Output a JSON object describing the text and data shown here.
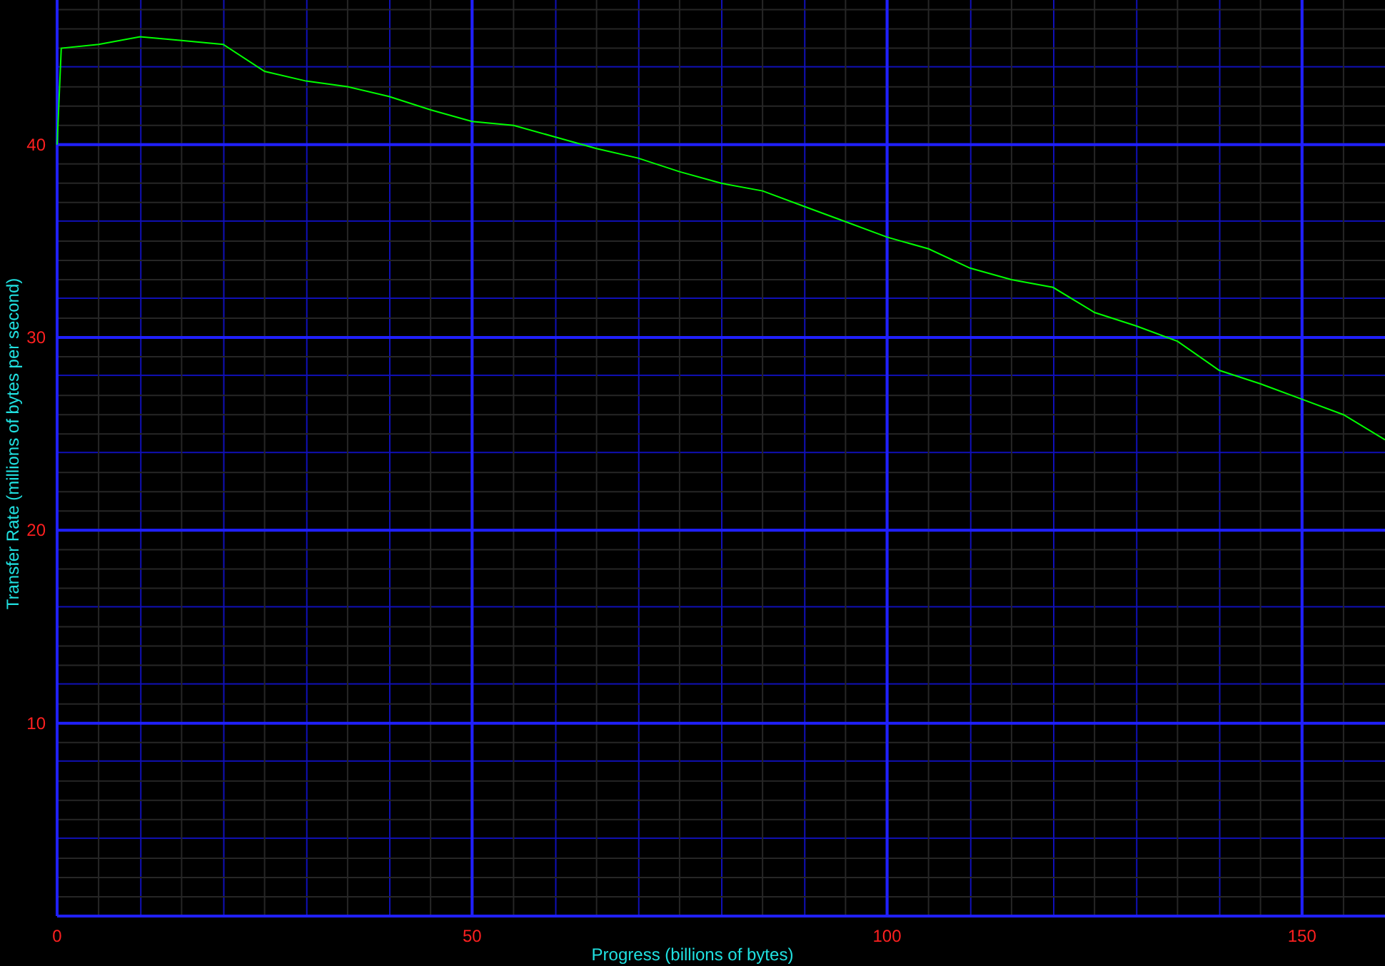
{
  "chart_data": {
    "type": "line",
    "xlabel": "Progress (billions of bytes)",
    "ylabel": "Transfer Rate (millions of bytes per second)",
    "xlim": [
      0,
      160
    ],
    "ylim": [
      0,
      47.5
    ],
    "xticks": [
      0,
      50,
      100,
      150
    ],
    "yticks": [
      10,
      20,
      30,
      40
    ],
    "grid": true,
    "x": [
      0,
      0.5,
      5,
      10,
      15,
      20,
      25,
      30,
      35,
      40,
      45,
      50,
      55,
      60,
      65,
      70,
      75,
      80,
      85,
      90,
      95,
      100,
      105,
      110,
      115,
      120,
      125,
      130,
      135,
      140,
      145,
      150,
      155,
      160
    ],
    "series": [
      {
        "color": "#00ff00",
        "values": [
          40,
          45,
          45.2,
          45.6,
          45.4,
          45.2,
          43.8,
          43.3,
          43.0,
          42.5,
          41.8,
          41.2,
          41.0,
          40.4,
          39.8,
          39.3,
          38.6,
          38.0,
          37.6,
          36.8,
          36.0,
          35.2,
          34.6,
          33.6,
          33.0,
          32.6,
          31.3,
          30.6,
          29.8,
          28.3,
          27.6,
          26.8,
          26.0,
          24.7
        ]
      }
    ]
  }
}
